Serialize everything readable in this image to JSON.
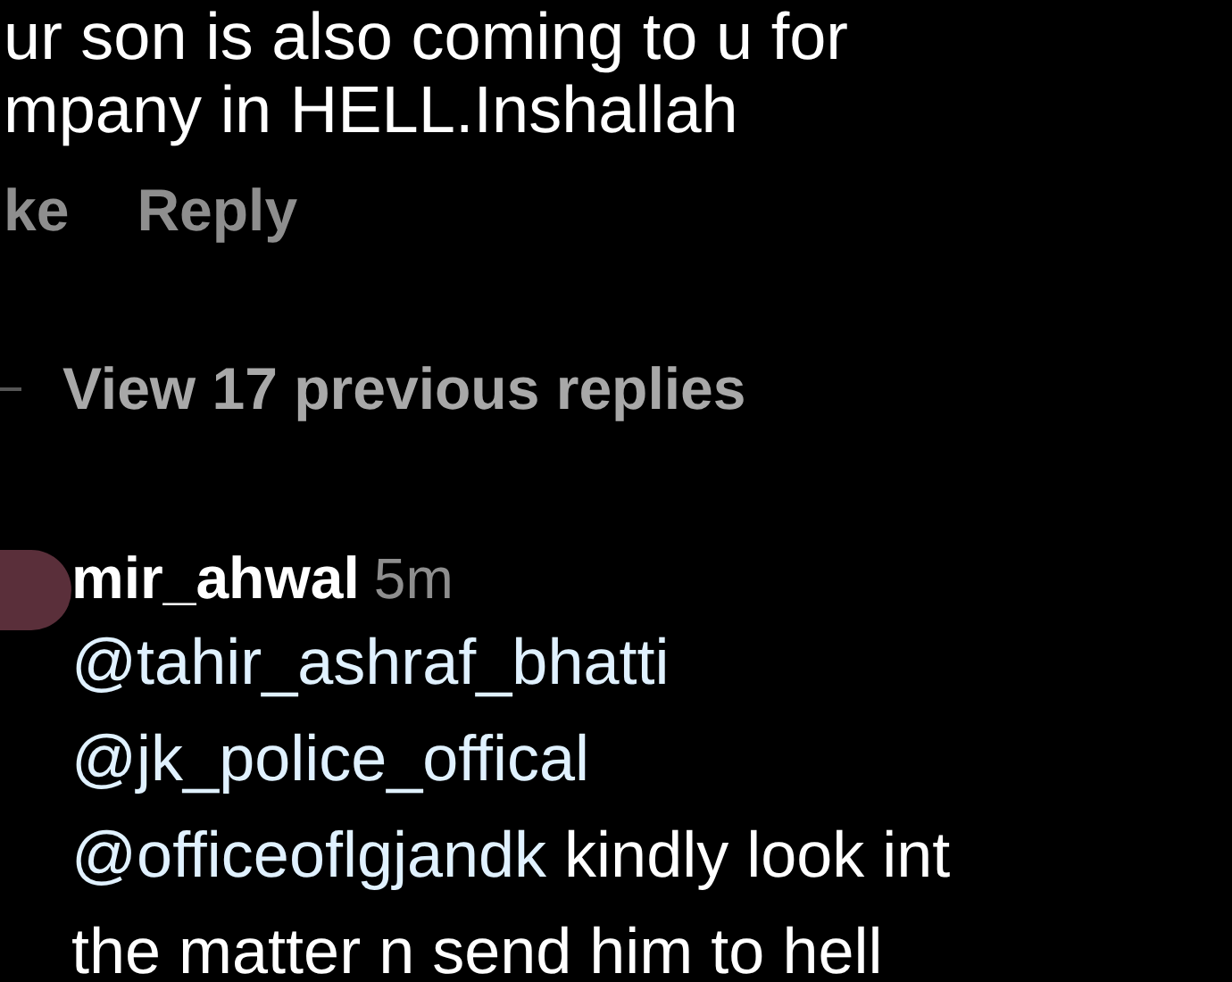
{
  "parent_comment": {
    "text_lines": [
      "ur son is also coming to u for",
      "mpany in HELL.Inshallah"
    ],
    "actions": [
      "ke",
      "Reply"
    ]
  },
  "view_replies": {
    "label": "View 17 previous replies"
  },
  "reply": {
    "username": "mir_ahwal",
    "time": "5m",
    "lines": [
      [
        {
          "kind": "mention",
          "text": "@tahir_ashraf_bhatti"
        }
      ],
      [
        {
          "kind": "mention",
          "text": "@jk_police_offical"
        }
      ],
      [
        {
          "kind": "mention",
          "text": "@officeoflgjandk"
        },
        {
          "kind": "text",
          "text": " kindly look int"
        }
      ],
      [
        {
          "kind": "text",
          "text": "the matter n send him to hell"
        }
      ]
    ]
  }
}
